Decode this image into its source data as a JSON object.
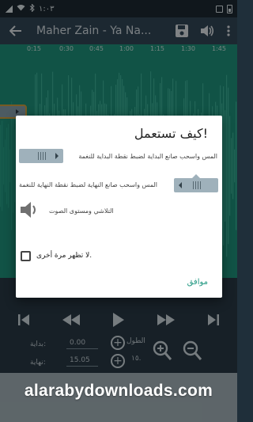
{
  "status_bar": {
    "time": "١:٠٣",
    "left_icons": [
      "wifi-icon",
      "bluetooth-icon",
      "signal-icon"
    ],
    "right_icons": [
      "battery-icon",
      "notification-icon"
    ]
  },
  "toolbar": {
    "title": "Maher Zain - Ya Na...",
    "icons": [
      "back-arrow-icon",
      "save-icon",
      "volume-icon",
      "more-options-icon"
    ]
  },
  "timeline": {
    "ticks": [
      "0:15",
      "0:30",
      "0:45",
      "1:00",
      "1:15",
      "1:30",
      "1:45"
    ]
  },
  "dialog": {
    "title": "كيف تستعمل!",
    "start_instruction": "المس واسحب صانع البداية لضبط نقطة البداية للنغمة",
    "end_instruction": "المس واسحب صانع النهاية لضبط نقطة النهاية للنغمة",
    "fade_text": "التلاشي ومستوى الصوت",
    "dont_show_label": "لا تظهر مرة أخرى.",
    "dont_show_checked": false,
    "ok_label": "موافق"
  },
  "controls": {
    "start_label": "بداية:",
    "start_value": "0.00",
    "end_label": "نهاية:",
    "end_value": "15.05",
    "length_label": "الطول",
    "length_value": "١٥."
  },
  "watermark": "alarabydownloads.com",
  "colors": {
    "accent": "#1f9780",
    "toolbar": "#34495a",
    "controls": "#2a3b47",
    "marker_border": "#d9a640"
  }
}
